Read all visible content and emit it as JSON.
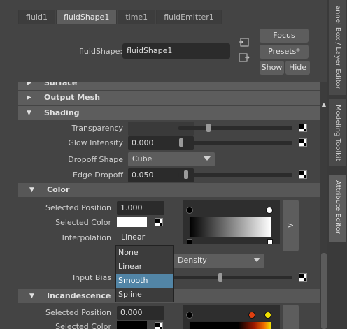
{
  "tabs": [
    {
      "label": "fluid1"
    },
    {
      "label": "fluidShape1"
    },
    {
      "label": "time1"
    },
    {
      "label": "fluidEmitter1"
    }
  ],
  "header": {
    "shape_label": "fluidShape:",
    "shape_value": "fluidShape1",
    "focus": "Focus",
    "presets": "Presets*",
    "show": "Show",
    "hide": "Hide"
  },
  "sections": {
    "surface": "Surface",
    "output_mesh": "Output Mesh",
    "shading": "Shading",
    "color": "Color",
    "incandescence": "Incandescence"
  },
  "shading": {
    "transparency_label": "Transparency",
    "glow_label": "Glow Intensity",
    "glow_value": "0.000",
    "dropoff_shape_label": "Dropoff Shape",
    "dropoff_shape_value": "Cube",
    "edge_dropoff_label": "Edge Dropoff",
    "edge_dropoff_value": "0.050"
  },
  "color": {
    "selected_position_label": "Selected Position",
    "selected_position_value": "1.000",
    "selected_color_label": "Selected Color",
    "interpolation_label": "Interpolation",
    "interpolation_value": "Linear",
    "color_input_value": "Density",
    "input_bias_label": "Input Bias",
    "expand_label": ">"
  },
  "interpolation_options": [
    "None",
    "Linear",
    "Smooth",
    "Spline"
  ],
  "interpolation_highlighted": "Smooth",
  "incandescence": {
    "selected_position_label": "Selected Position",
    "selected_position_value": "0.000",
    "selected_color_label": "Selected Color"
  },
  "right_tabs": [
    {
      "label": "annel Box / Layer Editor"
    },
    {
      "label": "Modeling Toolkit"
    },
    {
      "label": "Attribute Editor"
    }
  ],
  "colors": {
    "selection": "#5285a6",
    "panel": "#444444",
    "section_header": "#5d5d5d",
    "field": "#2b2b2b"
  }
}
